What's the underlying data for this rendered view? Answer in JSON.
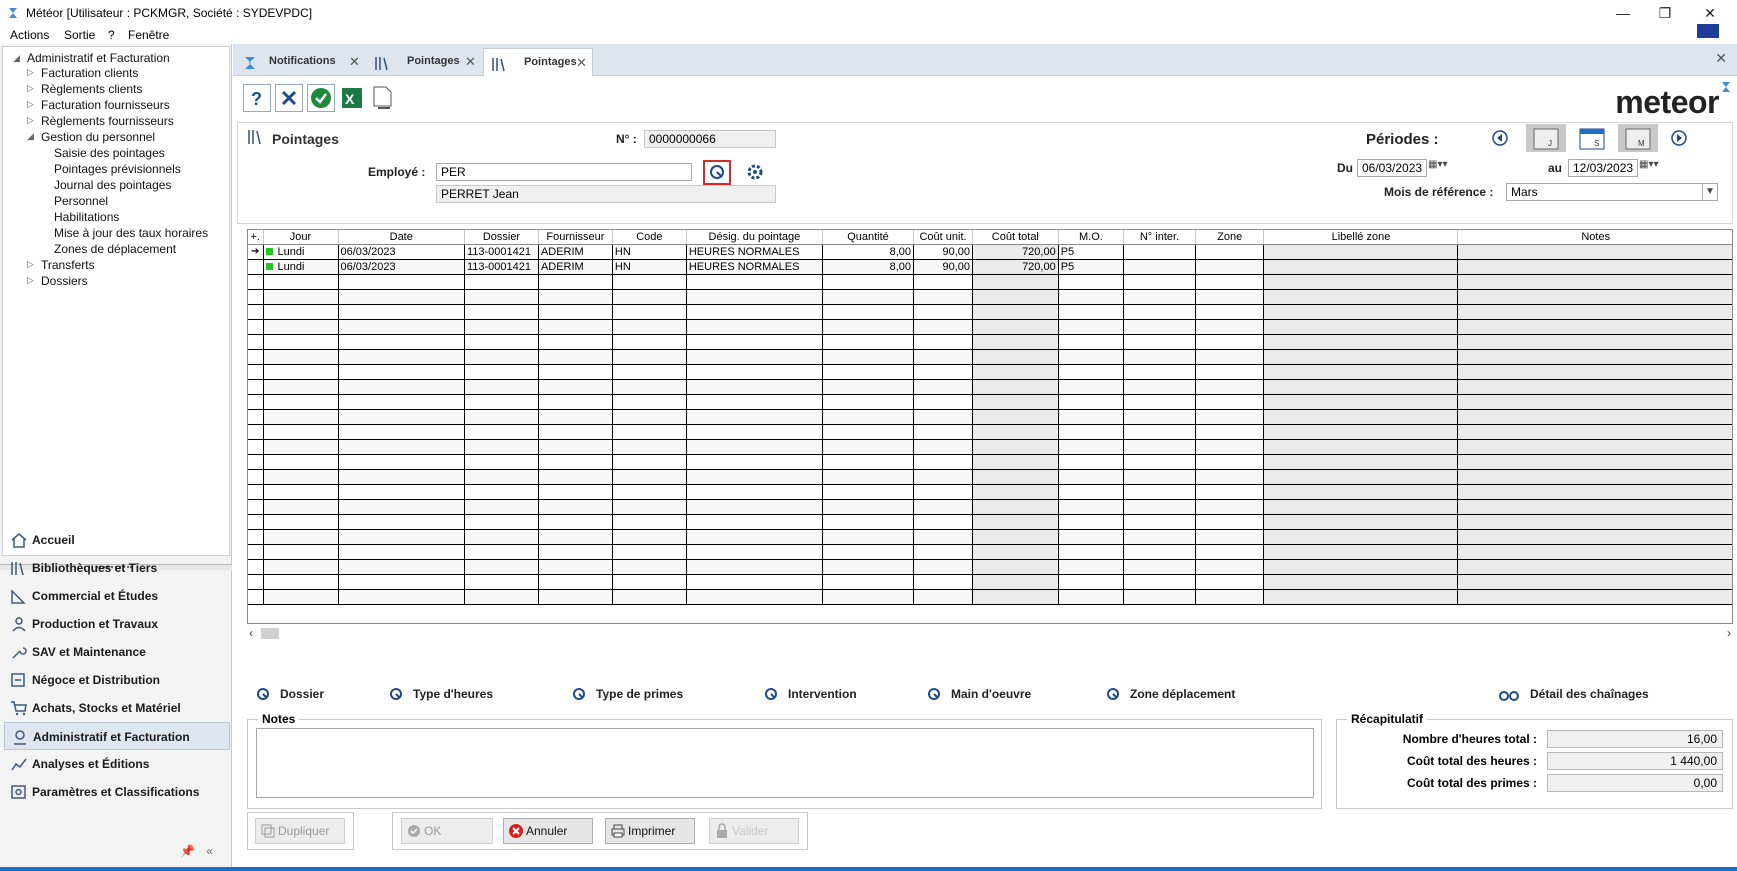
{
  "window": {
    "title": "Météor [Utilisateur : PCKMGR, Société : SYDEVPDC]",
    "minimize": "—",
    "restore": "❐",
    "close": "✕"
  },
  "menu": [
    "Actions",
    "Sortie",
    "?",
    "Fenêtre"
  ],
  "tree": {
    "root": "Administratif et Facturation",
    "items": [
      {
        "label": "Facturation clients",
        "level": 1,
        "expandable": true
      },
      {
        "label": "Règlements clients",
        "level": 1,
        "expandable": true
      },
      {
        "label": "Facturation fournisseurs",
        "level": 1,
        "expandable": true
      },
      {
        "label": "Règlements fournisseurs",
        "level": 1,
        "expandable": true
      },
      {
        "label": "Gestion du personnel",
        "level": 1,
        "expanded": true
      },
      {
        "label": "Saisie des pointages",
        "level": 2
      },
      {
        "label": "Pointages prévisionnels",
        "level": 2
      },
      {
        "label": "Journal des pointages",
        "level": 2
      },
      {
        "label": "Personnel",
        "level": 2
      },
      {
        "label": "Habilitations",
        "level": 2
      },
      {
        "label": "Mise à jour des taux horaires",
        "level": 2
      },
      {
        "label": "Zones de déplacement",
        "level": 2
      },
      {
        "label": "Transferts",
        "level": 1,
        "expandable": true
      },
      {
        "label": "Dossiers",
        "level": 1,
        "expandable": true
      }
    ]
  },
  "nav": [
    {
      "label": "Accueil",
      "icon": "home-icon"
    },
    {
      "label": "Bibliothèques et Tiers",
      "icon": "library-icon"
    },
    {
      "label": "Commercial et Études",
      "icon": "ruler-icon"
    },
    {
      "label": "Production et Travaux",
      "icon": "worker-icon"
    },
    {
      "label": "SAV et Maintenance",
      "icon": "wrench-icon"
    },
    {
      "label": "Négoce et Distribution",
      "icon": "trade-icon"
    },
    {
      "label": "Achats, Stocks et Matériel",
      "icon": "cart-icon"
    },
    {
      "label": "Administratif et Facturation",
      "icon": "admin-icon",
      "selected": true
    },
    {
      "label": "Analyses et Éditions",
      "icon": "chart-icon"
    },
    {
      "label": "Paramètres et Classifications",
      "icon": "settings-icon"
    }
  ],
  "tabs": [
    {
      "label": "Notifications",
      "icon": "notifications-icon"
    },
    {
      "label": "Pointages",
      "icon": "pointages-icon"
    },
    {
      "label": "Pointages",
      "icon": "pointages-icon",
      "active": true
    }
  ],
  "logo": "meteor",
  "form": {
    "title": "Pointages",
    "numero_label": "N° :",
    "numero_value": "0000000066",
    "employe_label": "Employé :",
    "employe_value": "PER",
    "employe_name": "PERRET  Jean",
    "periodes_label": "Périodes :",
    "du_label": "Du",
    "du_value": "06/03/2023",
    "au_label": "au",
    "au_value": "12/03/2023",
    "mois_label": "Mois de référence :",
    "mois_value": "Mars"
  },
  "grid": {
    "columns": [
      "Jour",
      "Date",
      "Dossier",
      "Fournisseur",
      "Code",
      "Désig. du pointage",
      "Quantité",
      "Coût unit.",
      "Coût total",
      "M.O.",
      "N° inter.",
      "Zone",
      "Libellé zone",
      "Notes"
    ],
    "rows": [
      [
        "Lundi",
        "06/03/2023",
        "113-0001421",
        "ADERIM",
        "HN",
        "HEURES NORMALES",
        "8,00",
        "90,00",
        "720,00",
        "P5",
        "",
        "",
        "",
        ""
      ],
      [
        "Lundi",
        "06/03/2023",
        "113-0001421",
        "ADERIM",
        "HN",
        "HEURES NORMALES",
        "8,00",
        "90,00",
        "720,00",
        "P5",
        "",
        "",
        "",
        ""
      ]
    ]
  },
  "links": [
    "Dossier",
    "Type d'heures",
    "Type de primes",
    "Intervention",
    "Main d'oeuvre",
    "Zone déplacement",
    "Détail des chaînages"
  ],
  "notes_label": "Notes",
  "recap": {
    "title": "Récapitulatif",
    "heures_label": "Nombre d'heures total :",
    "heures_value": "16,00",
    "cout_heures_label": "Coût total des heures :",
    "cout_heures_value": "1 440,00",
    "cout_primes_label": "Coût total des primes :",
    "cout_primes_value": "0,00"
  },
  "buttons": {
    "dupliquer": "Dupliquer",
    "ok": "OK",
    "annuler": "Annuler",
    "imprimer": "Imprimer",
    "valider": "Valider"
  }
}
